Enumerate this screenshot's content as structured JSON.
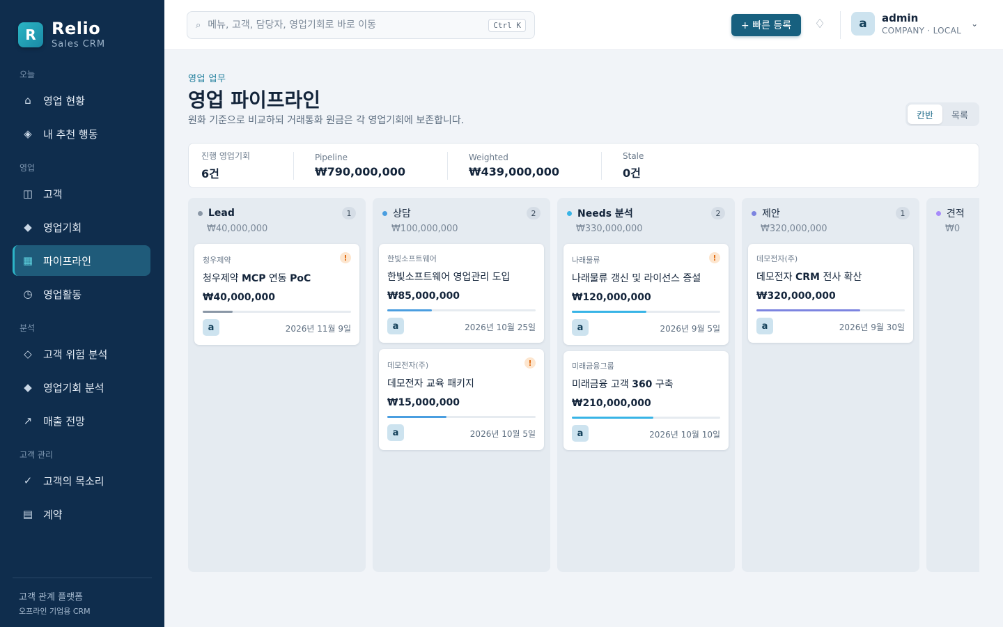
{
  "brand": {
    "logo_letter": "R",
    "name": "Relio",
    "sub": "Sales CRM"
  },
  "sidebar": {
    "sections": [
      "오늘",
      "영업",
      "분석",
      "고객 관리"
    ],
    "items": [
      {
        "label": "영업 현황",
        "icon": "home-icon",
        "glyph": "⌂"
      },
      {
        "label": "내 추천 행동",
        "icon": "diamond-icon",
        "glyph": "◈"
      },
      {
        "label": "고객",
        "icon": "columns-icon",
        "glyph": "◫"
      },
      {
        "label": "영업기회",
        "icon": "diamond-filled-icon",
        "glyph": "◆"
      },
      {
        "label": "파이프라인",
        "icon": "grid-icon",
        "glyph": "▦",
        "active": true
      },
      {
        "label": "영업활동",
        "icon": "clock-icon",
        "glyph": "◷"
      },
      {
        "label": "고객 위험 분석",
        "icon": "diamond-outline-icon",
        "glyph": "◇"
      },
      {
        "label": "영업기회 분석",
        "icon": "diamond-filled-icon",
        "glyph": "◆"
      },
      {
        "label": "매출 전망",
        "icon": "trend-arrow-icon",
        "glyph": "↗"
      },
      {
        "label": "고객의 목소리",
        "icon": "check-icon",
        "glyph": "✓"
      },
      {
        "label": "계약",
        "icon": "document-icon",
        "glyph": "▤"
      }
    ],
    "footer_line1": "고객 관계 플랫폼",
    "footer_line2": "오프라인 기업용 CRM"
  },
  "topbar": {
    "search_icon": "⌕",
    "search_placeholder": "메뉴, 고객, 담당자, 영업기회로 바로 이동",
    "shortcut": "Ctrl K",
    "quick_add": "+ 빠른 등록",
    "bell_glyph": "♢",
    "user_initial": "a",
    "user_name": "admin",
    "user_role": "COMPANY · LOCAL",
    "chevron": "⌄"
  },
  "header": {
    "eyebrow": "영업 업무",
    "title": "영업 파이프라인",
    "description": "원화 기준으로 비교하되 거래통화 원금은 각 영업기회에 보존합니다.",
    "view_kanban": "칸반",
    "view_list": "목록"
  },
  "stats": [
    {
      "label": "진행 영업기회",
      "value": "6건"
    },
    {
      "label": "Pipeline",
      "value": "₩790,000,000"
    },
    {
      "label": "Weighted",
      "value": "₩439,000,000"
    },
    {
      "label": "Stale",
      "value": "0건"
    }
  ],
  "colors": {
    "lead": "#8a97a6",
    "consult": "#4a9ee0",
    "needs": "#38b4e6",
    "proposal": "#7c84e0",
    "quote": "#a78bfa"
  },
  "columns": [
    {
      "title": "Lead",
      "count": "1",
      "total": "₩40,000,000",
      "dot": "#8a97a6",
      "cards": [
        {
          "company": "청우제약",
          "title": "청우제약 MCP 연동 PoC",
          "amount": "₩40,000,000",
          "progress": 0.2,
          "bar": "#8a97a6",
          "avatar": "a",
          "date": "2026년 11월 9일",
          "warn": true
        }
      ]
    },
    {
      "title": "상담",
      "count": "2",
      "total": "₩100,000,000",
      "dot": "#4a9ee0",
      "cards": [
        {
          "company": "한빛소프트웨어",
          "title": "한빛소프트웨어 영업관리 도입",
          "amount": "₩85,000,000",
          "progress": 0.3,
          "bar": "#4a9ee0",
          "avatar": "a",
          "date": "2026년 10월 25일",
          "warn": false
        },
        {
          "company": "데모전자(주)",
          "title": "데모전자 교육 패키지",
          "amount": "₩15,000,000",
          "progress": 0.4,
          "bar": "#4a9ee0",
          "avatar": "a",
          "date": "2026년 10월 5일",
          "warn": true
        }
      ]
    },
    {
      "title": "Needs 분석",
      "count": "2",
      "total": "₩330,000,000",
      "dot": "#38b4e6",
      "cards": [
        {
          "company": "나래물류",
          "title": "나래물류 갱신 및 라이선스 증설",
          "amount": "₩120,000,000",
          "progress": 0.5,
          "bar": "#38b4e6",
          "avatar": "a",
          "date": "2026년 9월 5일",
          "warn": true
        },
        {
          "company": "미래금융그룹",
          "title": "미래금융 고객 360 구축",
          "amount": "₩210,000,000",
          "progress": 0.55,
          "bar": "#38b4e6",
          "avatar": "a",
          "date": "2026년 10월 10일",
          "warn": false
        }
      ]
    },
    {
      "title": "제안",
      "count": "1",
      "total": "₩320,000,000",
      "dot": "#7c84e0",
      "cards": [
        {
          "company": "데모전자(주)",
          "title": "데모전자 CRM 전사 확산",
          "amount": "₩320,000,000",
          "progress": 0.7,
          "bar": "#7c84e0",
          "avatar": "a",
          "date": "2026년 9월 30일",
          "warn": false
        }
      ]
    },
    {
      "title": "견적",
      "count": "",
      "total": "₩0",
      "dot": "#a78bfa",
      "cards": []
    }
  ]
}
